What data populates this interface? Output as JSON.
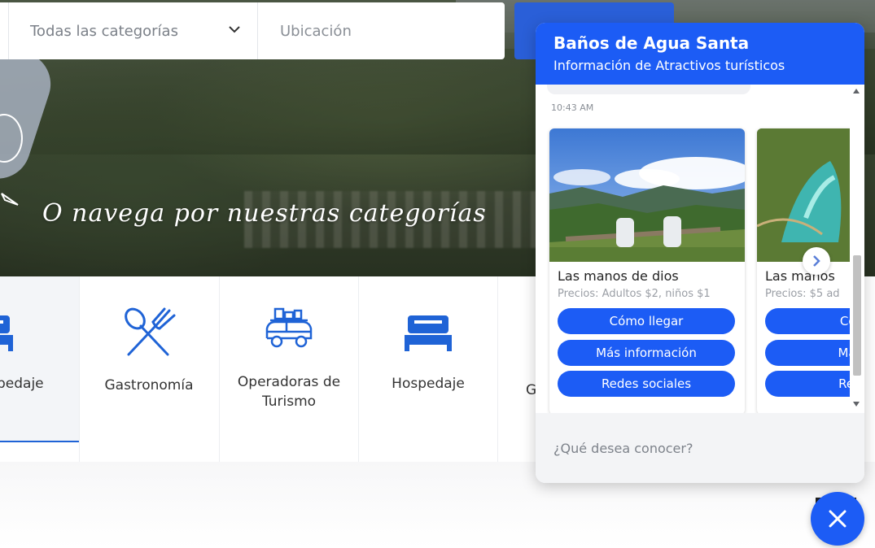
{
  "search": {
    "category_value": "Todas las categorías",
    "location_placeholder": "Ubicación"
  },
  "hero": {
    "tagline": "O navega por nuestras categorías"
  },
  "categories": [
    {
      "label": "pedaje",
      "icon": "bed-icon",
      "active": true
    },
    {
      "label": "Gastronomía",
      "icon": "fork-spoon-icon",
      "active": false
    },
    {
      "label": "Operadoras de Turismo",
      "icon": "car-luggage-icon",
      "active": false
    },
    {
      "label": "Hospedaje",
      "icon": "bed-icon",
      "active": false
    },
    {
      "label": "G",
      "icon": "",
      "active": false
    }
  ],
  "chat": {
    "title": "Baños de Agua Santa",
    "subtitle": "Información de Atractivos turísticos",
    "timestamp": "10:43 AM",
    "input_placeholder": "¿Qué desea conocer?",
    "cards": [
      {
        "title": "Las manos de dios",
        "subtitle": "Precios: Adultos $2, niños $1",
        "buttons": [
          "Cómo llegar",
          "Más información",
          "Redes sociales"
        ]
      },
      {
        "title": "Las manos",
        "subtitle": "Precios: $5 ad",
        "buttons": [
          "Cóm",
          "Más i",
          "Rede"
        ]
      }
    ]
  },
  "colors": {
    "accent": "#1c5cf5",
    "category_icon": "#1f63d6"
  }
}
